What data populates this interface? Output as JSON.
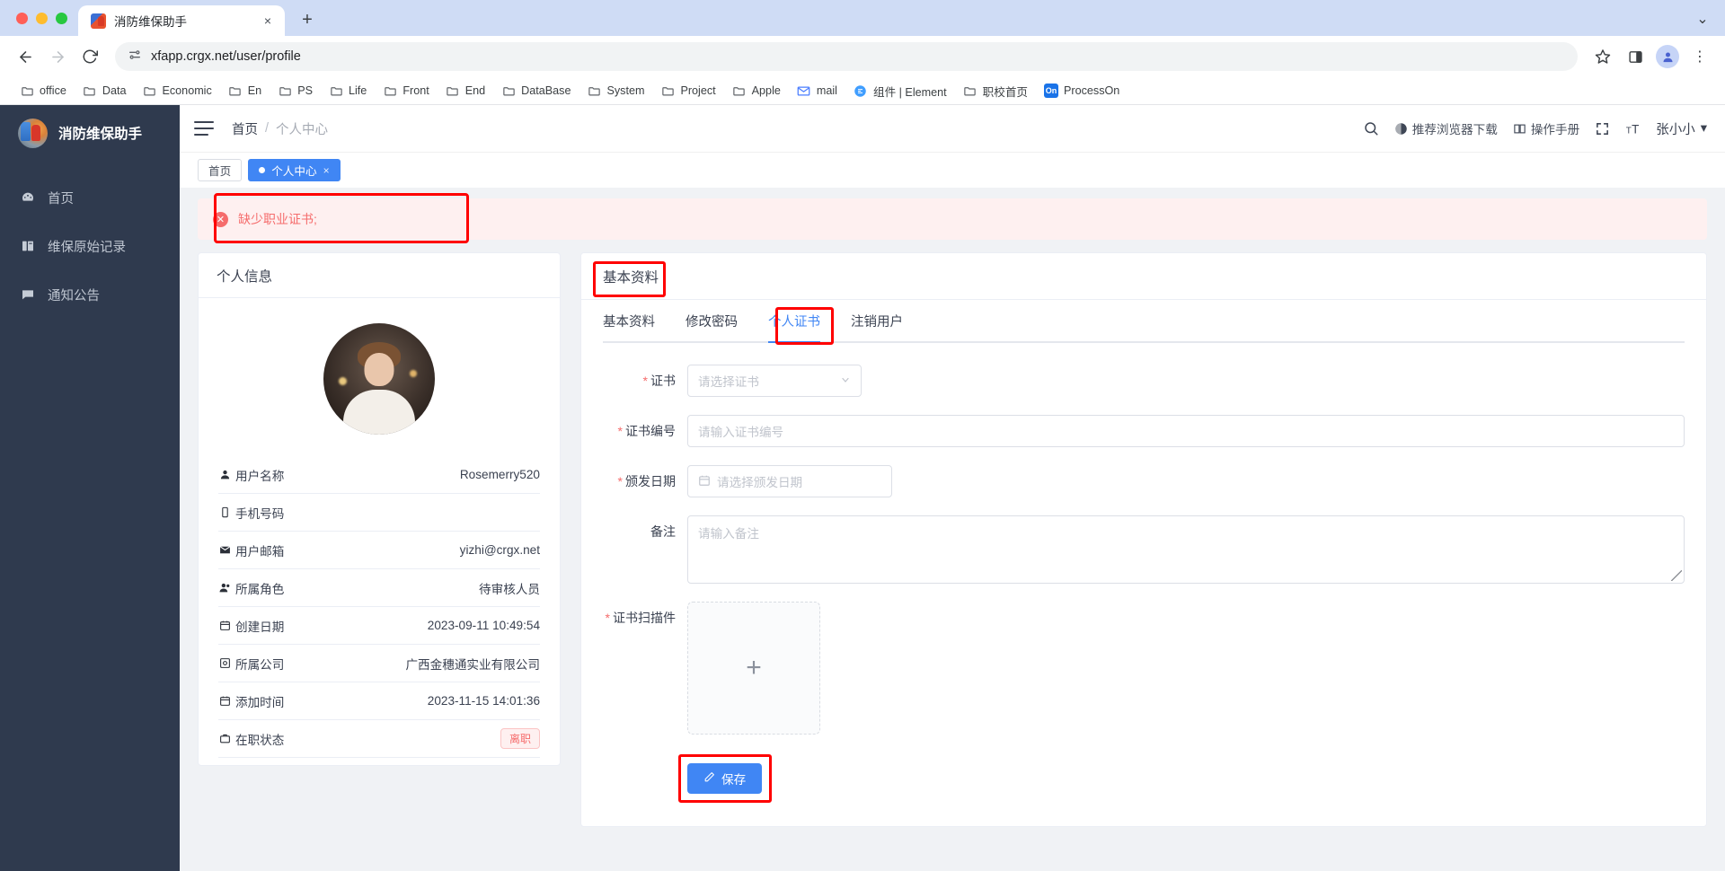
{
  "browser": {
    "tab": {
      "title": "消防维保助手",
      "favicon": "app-favicon",
      "close": "×"
    },
    "new_tab": "+",
    "tabstrip_menu": "⌄",
    "nav": {
      "back": "←",
      "forward": "→",
      "reload": "⟳"
    },
    "omnibox": {
      "url": "xfapp.crgx.net/user/profile",
      "site_settings_icon": "tune-icon"
    },
    "actions": {
      "bookmark": "☆",
      "side_panel": "side-panel-icon",
      "profile": "profile-icon",
      "menu": "⋮"
    },
    "bookmarks": [
      {
        "label": "office",
        "icon": "folder"
      },
      {
        "label": "Data",
        "icon": "folder"
      },
      {
        "label": "Economic",
        "icon": "folder"
      },
      {
        "label": "En",
        "icon": "folder"
      },
      {
        "label": "PS",
        "icon": "folder"
      },
      {
        "label": "Life",
        "icon": "folder"
      },
      {
        "label": "Front",
        "icon": "folder"
      },
      {
        "label": "End",
        "icon": "folder"
      },
      {
        "label": "DataBase",
        "icon": "folder"
      },
      {
        "label": "System",
        "icon": "folder"
      },
      {
        "label": "Project",
        "icon": "folder"
      },
      {
        "label": "Apple",
        "icon": "folder"
      },
      {
        "label": "mail",
        "icon": "mail"
      },
      {
        "label": "组件 | Element",
        "icon": "element"
      },
      {
        "label": "职校首页",
        "icon": "folder"
      },
      {
        "label": "ProcessOn",
        "icon": "on"
      }
    ]
  },
  "sidebar": {
    "brand": "消防维保助手",
    "items": [
      {
        "label": "首页",
        "icon": "dashboard-icon"
      },
      {
        "label": "维保原始记录",
        "icon": "book-icon"
      },
      {
        "label": "通知公告",
        "icon": "message-icon"
      }
    ]
  },
  "topbar": {
    "breadcrumb": {
      "home": "首页",
      "sep": "/",
      "current": "个人中心"
    },
    "search_icon": "search-icon",
    "browser_download": {
      "label": "推荐浏览器下载",
      "icon": "globe-icon"
    },
    "manual": {
      "label": "操作手册",
      "icon": "book-open-icon"
    },
    "fullscreen_icon": "fullscreen-icon",
    "fontsize_icon": "font-size-icon",
    "user": {
      "name": "张小小",
      "caret": "▾"
    }
  },
  "tagbar": {
    "tags": [
      {
        "label": "首页",
        "active": false,
        "closable": false
      },
      {
        "label": "个人中心",
        "active": true,
        "closable": true,
        "close": "×"
      }
    ]
  },
  "alert": {
    "text": "缺少职业证书;",
    "icon": "✕",
    "color": "#f56c6c",
    "bg": "#fef0f0"
  },
  "info_card": {
    "title": "个人信息",
    "avatar": "user-avatar",
    "rows": [
      {
        "label": "用户名称",
        "icon": "user-icon",
        "value": "Rosemerry520"
      },
      {
        "label": "手机号码",
        "icon": "phone-icon",
        "value": ""
      },
      {
        "label": "用户邮箱",
        "icon": "mail-icon",
        "value": "yizhi@crgx.net"
      },
      {
        "label": "所属角色",
        "icon": "users-icon",
        "value": "待审核人员"
      },
      {
        "label": "创建日期",
        "icon": "calendar-icon",
        "value": "2023-09-11 10:49:54"
      },
      {
        "label": "所属公司",
        "icon": "building-icon",
        "value": "广西金穗通实业有限公司"
      },
      {
        "label": "添加时间",
        "icon": "calendar-icon",
        "value": "2023-11-15 14:01:36"
      },
      {
        "label": "在职状态",
        "icon": "status-icon",
        "value": "离职",
        "is_badge": true
      }
    ]
  },
  "form_card": {
    "title": "基本资料",
    "tabs": [
      {
        "label": "基本资料",
        "active": false
      },
      {
        "label": "修改密码",
        "active": false
      },
      {
        "label": "个人证书",
        "active": true
      },
      {
        "label": "注销用户",
        "active": false
      }
    ],
    "fields": {
      "certificate": {
        "label": "证书",
        "required": true,
        "placeholder": "请选择证书",
        "value": "",
        "arrow": "⌄"
      },
      "cert_no": {
        "label": "证书编号",
        "required": true,
        "placeholder": "请输入证书编号",
        "value": ""
      },
      "issue_date": {
        "label": "颁发日期",
        "required": true,
        "placeholder": "请选择颁发日期",
        "value": "",
        "icon": "calendar-icon"
      },
      "remark": {
        "label": "备注",
        "required": false,
        "placeholder": "请输入备注",
        "value": ""
      },
      "scan": {
        "label": "证书扫描件",
        "required": true,
        "plus": "+"
      }
    },
    "save_button": {
      "label": "保存",
      "icon": "pencil-icon",
      "color": "#4086f4"
    }
  },
  "highlights": {
    "color": "#ff0000"
  }
}
